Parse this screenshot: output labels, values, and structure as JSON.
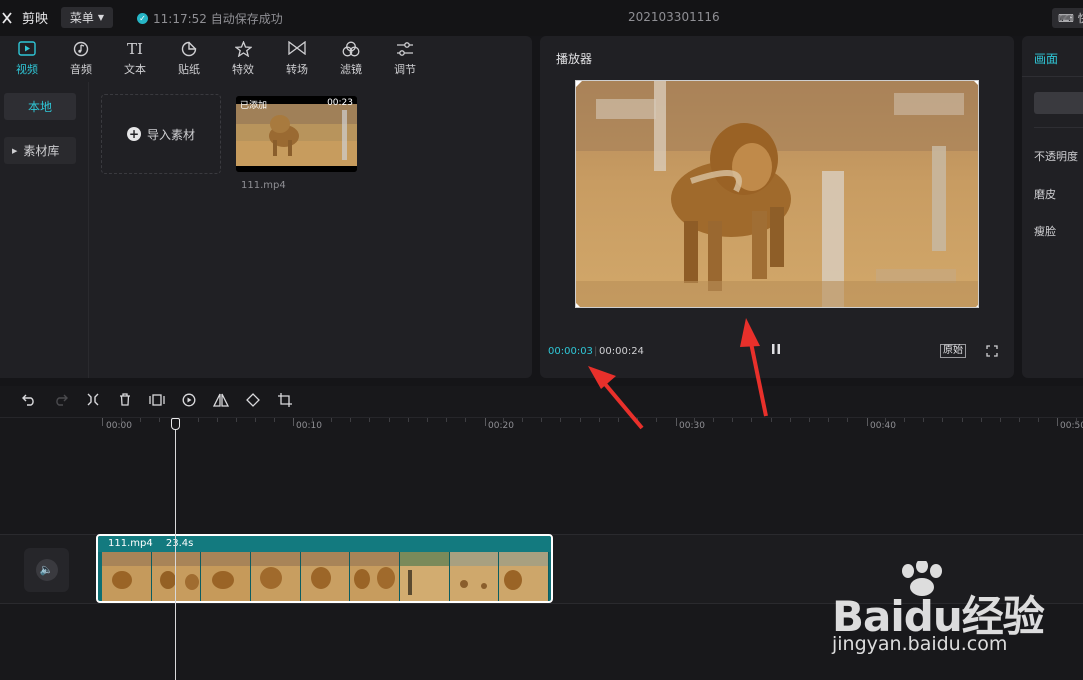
{
  "app": {
    "logo_text": "剪映",
    "menu_label": "菜单",
    "save_status": "11:17:52 自动保存成功",
    "project_name": "202103301116",
    "shortcut_label": "快"
  },
  "media": {
    "tabs": [
      {
        "label": "视频",
        "icon": "video-icon"
      },
      {
        "label": "音频",
        "icon": "music-icon"
      },
      {
        "label": "文本",
        "icon": "text-icon"
      },
      {
        "label": "贴纸",
        "icon": "sticker-icon"
      },
      {
        "label": "特效",
        "icon": "effects-icon"
      },
      {
        "label": "转场",
        "icon": "transition-icon"
      },
      {
        "label": "滤镜",
        "icon": "filter-icon"
      },
      {
        "label": "调节",
        "icon": "adjust-icon"
      }
    ],
    "side_local": "本地",
    "side_library": "素材库",
    "import_label": "导入素材",
    "thumb_badge": "已添加",
    "thumb_duration": "00:23",
    "thumb_filename": "111.mp4"
  },
  "player": {
    "title": "播放器",
    "current_time": "00:00:03",
    "total_time": "00:00:24",
    "original_label": "原始"
  },
  "props": {
    "tab_label": "画面",
    "items": [
      "不透明度",
      "磨皮",
      "瘦脸"
    ]
  },
  "timeline": {
    "ticks": [
      "00:00",
      "00:10",
      "00:20",
      "00:30",
      "00:40",
      "00:50"
    ],
    "clip_name": "111.mp4",
    "clip_duration": "23.4s"
  },
  "watermark": {
    "main": "Baidu经验",
    "sub": "jingyan.baidu.com"
  },
  "colors": {
    "accent": "#2fc6d6",
    "clip_bg": "#137a7f",
    "arrow": "#e8302b"
  }
}
